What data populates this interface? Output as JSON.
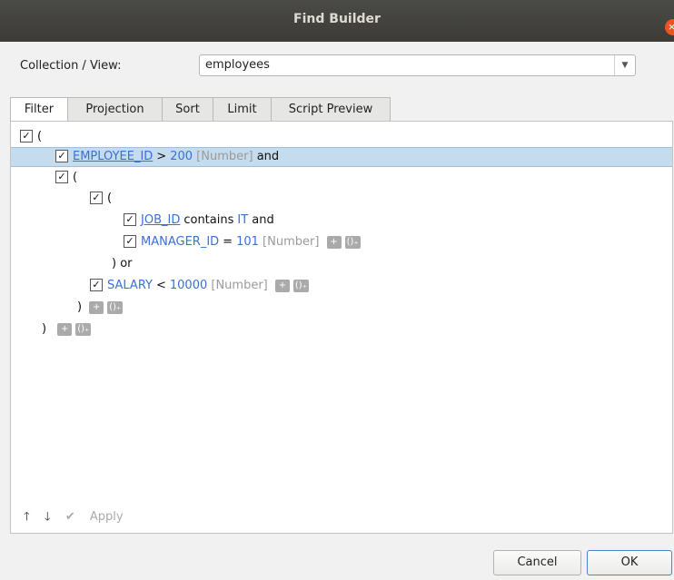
{
  "window": {
    "title": "Find Builder",
    "close_glyph": "×"
  },
  "collection": {
    "label": "Collection / View:",
    "value": "employees"
  },
  "tabs": [
    "Filter",
    "Projection",
    "Sort",
    "Limit",
    "Script Preview"
  ],
  "active_tab": "Filter",
  "filter_tree": {
    "root_open": "(",
    "cond1": {
      "field": "EMPLOYEE_ID",
      "op": ">",
      "value": "200",
      "type": "[Number]",
      "join": "and"
    },
    "group1_open": "(",
    "group2_open": "(",
    "cond2": {
      "field": "JOB_ID",
      "op": "contains",
      "value": "IT",
      "join": "and"
    },
    "cond3": {
      "field": "MANAGER_ID",
      "op": "=",
      "value": "101",
      "type": "[Number]"
    },
    "group2_close": ") or",
    "cond4": {
      "field": "SALARY",
      "op": "<",
      "value": "10000",
      "type": "[Number]"
    },
    "group1_close": ")",
    "root_close": ")",
    "add_label": "+",
    "group_add_label": "()₊"
  },
  "content_toolbar": {
    "up": "🡑",
    "down": "🡓",
    "apply_icon": "✔",
    "apply_label": "Apply"
  },
  "footer": {
    "cancel": "Cancel",
    "ok": "OK"
  }
}
